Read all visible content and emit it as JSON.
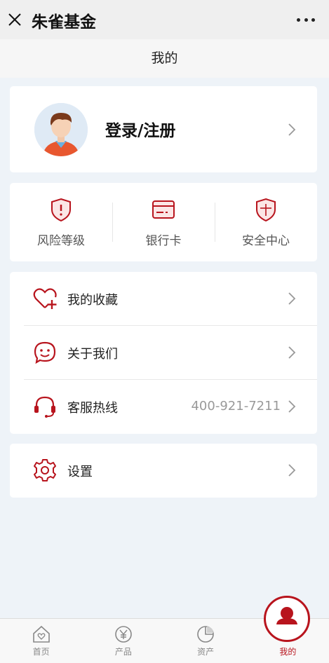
{
  "topbar": {
    "title": "朱雀基金",
    "close_icon": "close-icon",
    "more_icon": "more-icon"
  },
  "page": {
    "title": "我的"
  },
  "profile": {
    "login_label": "登录/注册",
    "avatar_icon": "avatar-icon"
  },
  "quick_actions": [
    {
      "label": "风险等级",
      "icon": "risk-shield-icon"
    },
    {
      "label": "银行卡",
      "icon": "bank-card-icon"
    },
    {
      "label": "安全中心",
      "icon": "security-shield-icon"
    }
  ],
  "menu": {
    "favorites": {
      "label": "我的收藏",
      "icon": "heart-plus-icon"
    },
    "about": {
      "label": "关于我们",
      "icon": "smile-icon"
    },
    "hotline": {
      "label": "客服热线",
      "value": "400-921-7211",
      "icon": "headset-icon"
    },
    "settings": {
      "label": "设置",
      "icon": "gear-icon"
    }
  },
  "tabbar": [
    {
      "label": "首页",
      "icon": "home-icon"
    },
    {
      "label": "产品",
      "icon": "yuan-icon"
    },
    {
      "label": "资产",
      "icon": "pie-icon"
    },
    {
      "label": "我的",
      "icon": "user-icon",
      "active": true
    }
  ],
  "colors": {
    "accent": "#b8141d",
    "background": "#eef3f8",
    "topbar": "#efefef"
  }
}
